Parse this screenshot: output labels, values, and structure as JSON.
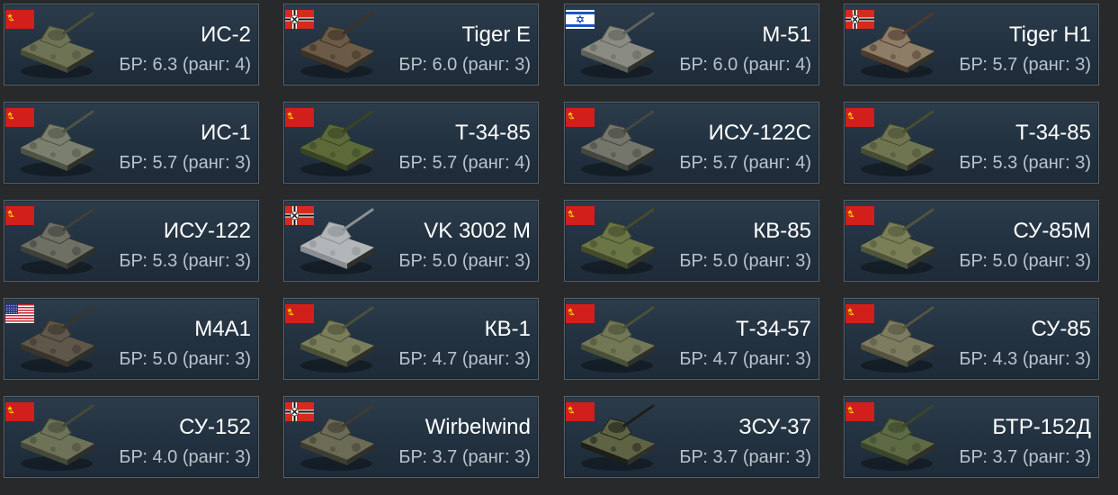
{
  "vehicles": [
    {
      "flag": "ussr-flag-icon",
      "name": "ИС-2",
      "br": "БР: 6.3 (ранг: 4)",
      "hull": "#6f7356",
      "camo": "#4a4d38"
    },
    {
      "flag": "germany-flag-icon",
      "name": "Tiger E",
      "br": "БР: 6.0 (ранг: 3)",
      "hull": "#6b5a45",
      "camo": "#3d3226"
    },
    {
      "flag": "israel-flag-icon",
      "name": "M-51",
      "br": "БР: 6.0 (ранг: 4)",
      "hull": "#8a8c84",
      "camo": "#5e605a"
    },
    {
      "flag": "germany-flag-icon",
      "name": "Tiger H1",
      "br": "БР: 5.7 (ранг: 3)",
      "hull": "#8d7c66",
      "camo": "#4e3b2d"
    },
    {
      "flag": "ussr-flag-icon",
      "name": "ИС-1",
      "br": "БР: 5.7 (ранг: 3)",
      "hull": "#7b7f6d",
      "camo": "#4f5344"
    },
    {
      "flag": "ussr-flag-icon",
      "name": "Т-34-85",
      "br": "БР: 5.7 (ранг: 4)",
      "hull": "#5c6a38",
      "camo": "#3a4424"
    },
    {
      "flag": "ussr-flag-icon",
      "name": "ИСУ-122С",
      "br": "БР: 5.7 (ранг: 4)",
      "hull": "#74766c",
      "camo": "#45473f"
    },
    {
      "flag": "ussr-flag-icon",
      "name": "Т-34-85",
      "br": "БР: 5.3 (ранг: 3)",
      "hull": "#6e7550",
      "camo": "#474d32"
    },
    {
      "flag": "ussr-flag-icon",
      "name": "ИСУ-122",
      "br": "БР: 5.3 (ранг: 3)",
      "hull": "#6f7064",
      "camo": "#3f403a"
    },
    {
      "flag": "germany-flag-icon",
      "name": "VK 3002 M",
      "br": "БР: 5.0 (ранг: 3)",
      "hull": "#b3b6b8",
      "camo": "#8b8e92"
    },
    {
      "flag": "ussr-flag-icon",
      "name": "КВ-85",
      "br": "БР: 5.0 (ранг: 3)",
      "hull": "#6b7646",
      "camo": "#434b2b"
    },
    {
      "flag": "ussr-flag-icon",
      "name": "СУ-85М",
      "br": "БР: 5.0 (ранг: 3)",
      "hull": "#7a7f58",
      "camo": "#50553a"
    },
    {
      "flag": "usa-flag-icon",
      "name": "M4A1",
      "br": "БР: 5.0 (ранг: 3)",
      "hull": "#5f574a",
      "camo": "#3a342b"
    },
    {
      "flag": "ussr-flag-icon",
      "name": "КВ-1",
      "br": "БР: 4.7 (ранг: 3)",
      "hull": "#7a7e5a",
      "camo": "#4c4f38"
    },
    {
      "flag": "ussr-flag-icon",
      "name": "Т-34-57",
      "br": "БР: 4.7 (ранг: 3)",
      "hull": "#727856",
      "camo": "#4a4f37"
    },
    {
      "flag": "ussr-flag-icon",
      "name": "СУ-85",
      "br": "БР: 4.3 (ранг: 3)",
      "hull": "#7d7c60",
      "camo": "#54533f"
    },
    {
      "flag": "ussr-flag-icon",
      "name": "СУ-152",
      "br": "БР: 4.0 (ранг: 3)",
      "hull": "#6e7358",
      "camo": "#454937"
    },
    {
      "flag": "germany-flag-icon",
      "name": "Wirbelwind",
      "br": "БР: 3.7 (ранг: 3)",
      "hull": "#6c6b55",
      "camo": "#3d3c30"
    },
    {
      "flag": "ussr-flag-icon",
      "name": "ЗСУ-37",
      "br": "БР: 3.7 (ранг: 3)",
      "hull": "#5e6343",
      "camo": "#1d1f18"
    },
    {
      "flag": "ussr-flag-icon",
      "name": "БТР-152Д",
      "br": "БР: 3.7 (ранг: 3)",
      "hull": "#5e6a43",
      "camo": "#3b452a"
    }
  ]
}
